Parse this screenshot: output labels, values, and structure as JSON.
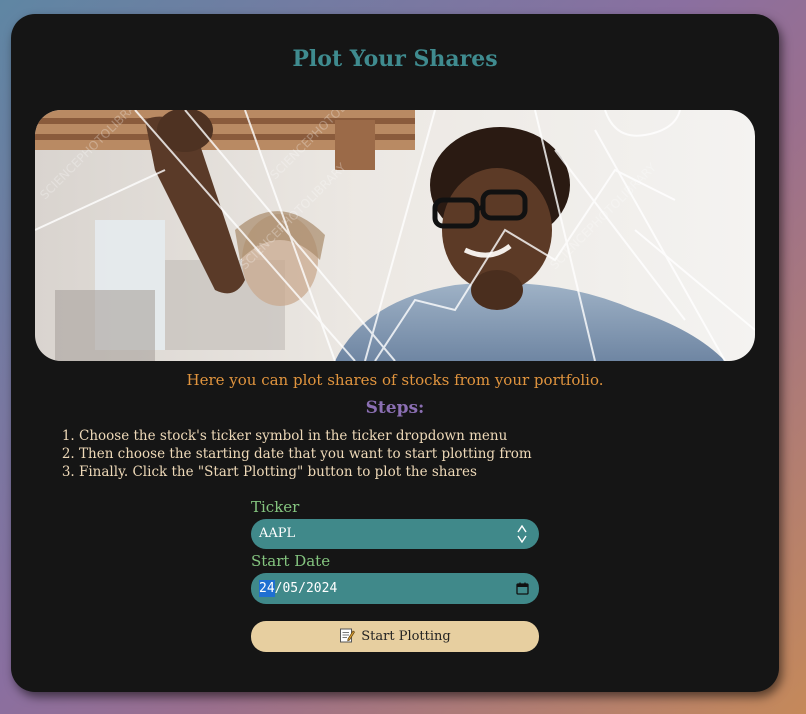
{
  "page": {
    "title": "Plot Your Shares",
    "intro": "Here you can plot shares of stocks from your portfolio.",
    "steps_title": "Steps:",
    "steps": [
      "Choose the stock's ticker symbol in the ticker dropdown menu",
      "Then choose the starting date that you want to start plotting from",
      "Finally. Click the \"Start Plotting\" button to plot the shares"
    ],
    "hero_watermark": "SCIENCEPHOTOLIBRARY"
  },
  "form": {
    "ticker_label": "Ticker",
    "ticker_value": "AAPL",
    "start_date_label": "Start Date",
    "start_date_day": "24",
    "start_date_rest": "/05/2024",
    "submit_label": "Start Plotting"
  },
  "colors": {
    "title": "#3f8b8f",
    "intro": "#e0943e",
    "steps_title": "#8b6fb3",
    "label": "#84c47f",
    "field_bg": "#40898a",
    "button_bg": "#e7cfa0",
    "card_bg": "#151515"
  },
  "icons": {
    "select_arrows": "select-arrows-icon",
    "calendar": "calendar-icon",
    "memo": "memo-icon"
  }
}
